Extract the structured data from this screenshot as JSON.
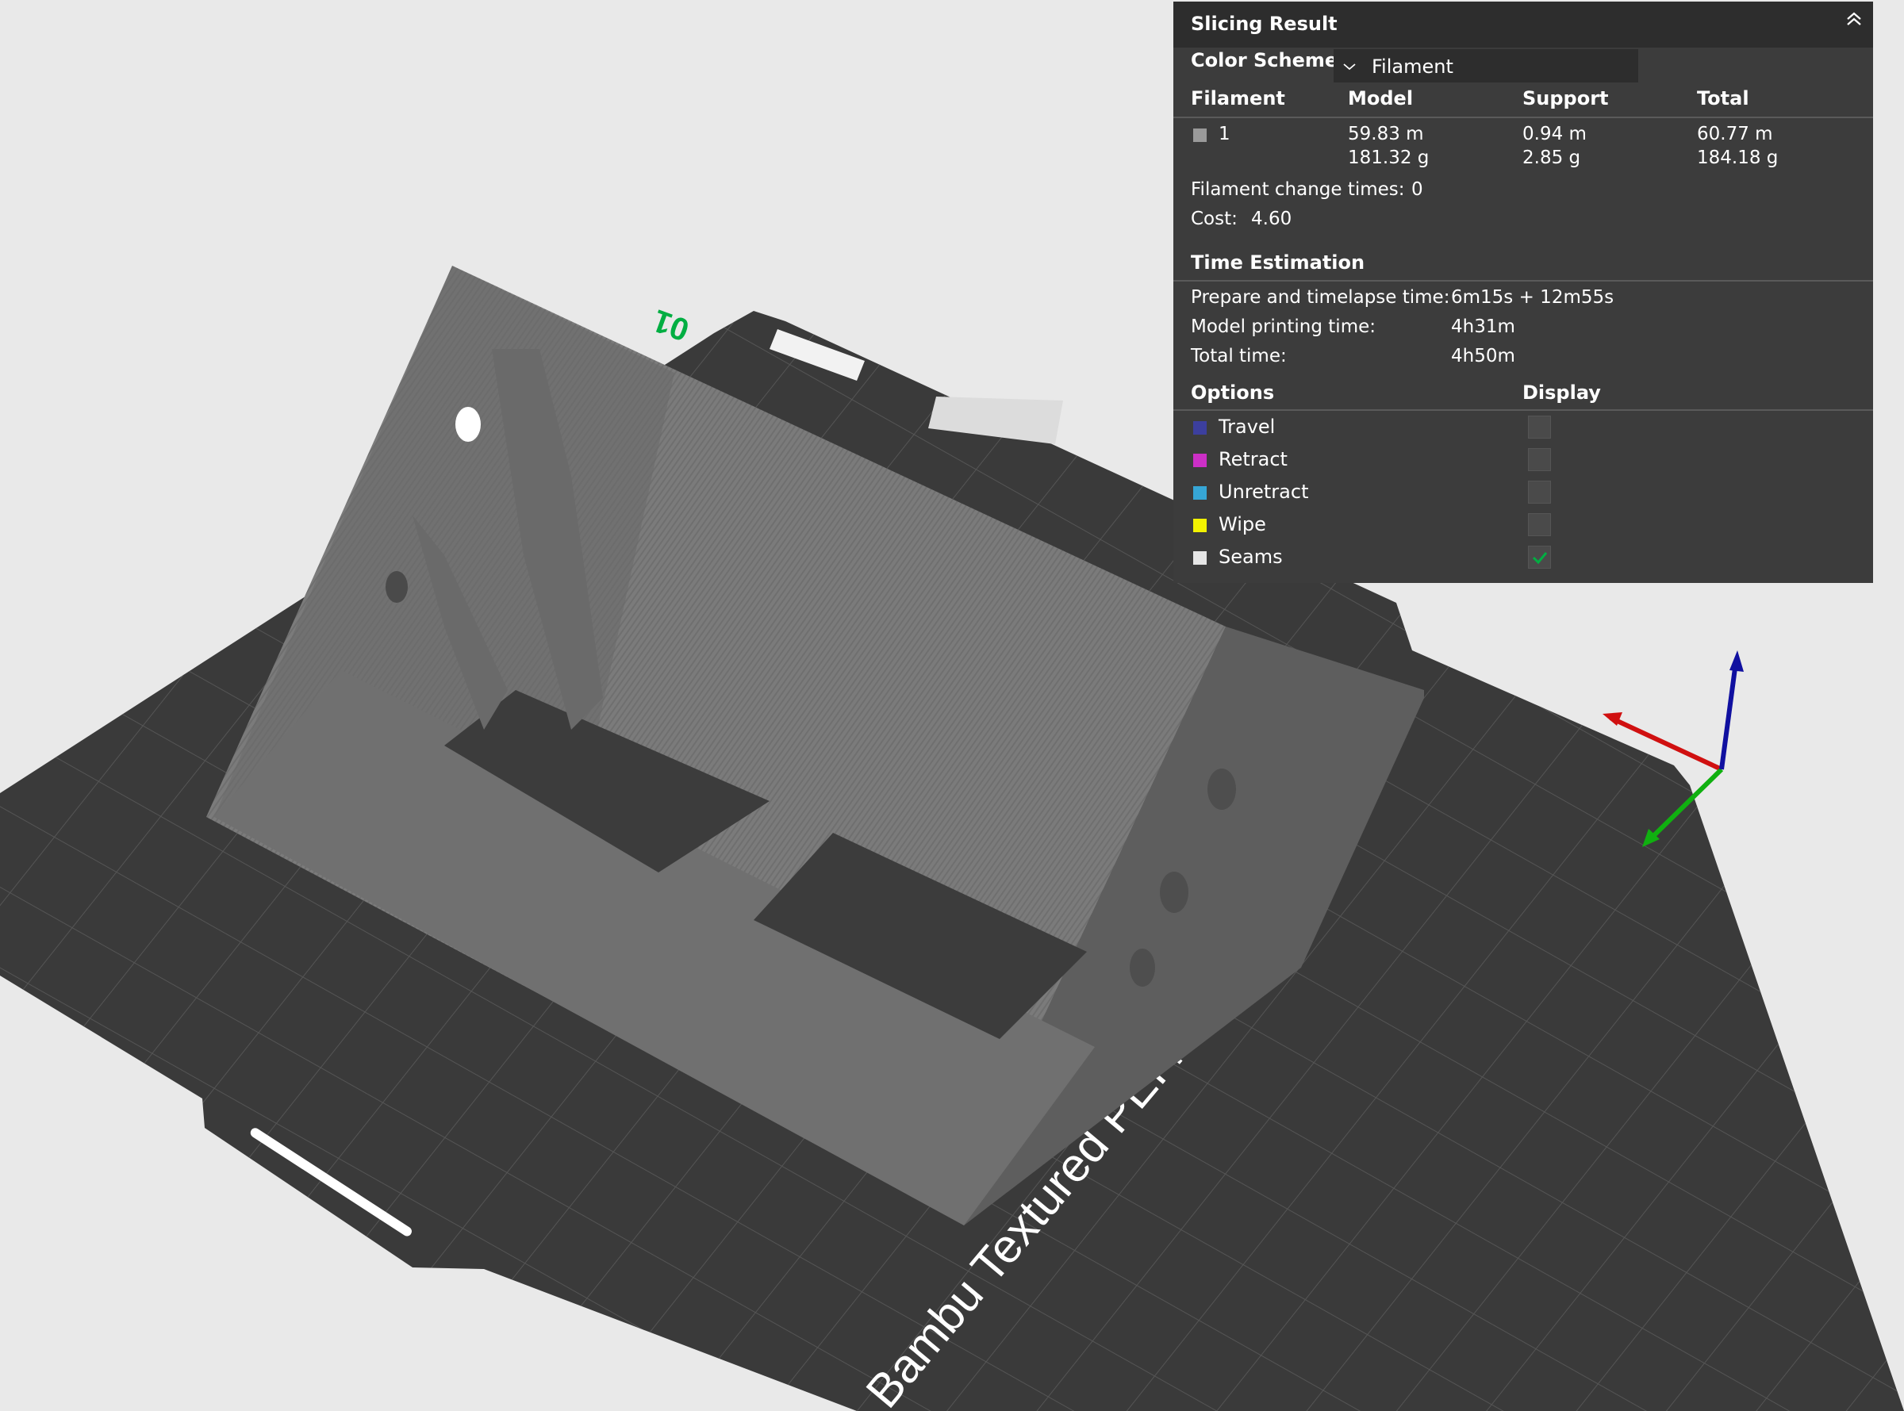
{
  "panel": {
    "title": "Slicing Result",
    "color_scheme_label": "Color Scheme",
    "color_scheme_value": "Filament",
    "table": {
      "headers": [
        "Filament",
        "Model",
        "Support",
        "Total"
      ],
      "rows": [
        {
          "filament": "1",
          "model_length": "59.83 m",
          "model_weight": "181.32 g",
          "support_length": "0.94 m",
          "support_weight": "2.85 g",
          "total_length": "60.77 m",
          "total_weight": "184.18 g"
        }
      ]
    },
    "filament_change_label": "Filament change times:",
    "filament_change_value": "0",
    "cost_label": "Cost:",
    "cost_value": "4.60",
    "time_estimation": {
      "title": "Time Estimation",
      "rows": [
        {
          "label": "Prepare and timelapse time:",
          "value": "6m15s + 12m55s"
        },
        {
          "label": "Model printing time:",
          "value": "4h31m"
        },
        {
          "label": "Total time:",
          "value": "4h50m"
        }
      ]
    },
    "options": {
      "title": "Options",
      "display_title": "Display",
      "items": [
        {
          "label": "Travel",
          "color": "#3c3f9e",
          "checked": false
        },
        {
          "label": "Retract",
          "color": "#cc2fc6",
          "checked": false
        },
        {
          "label": "Unretract",
          "color": "#36a6d6",
          "checked": false
        },
        {
          "label": "Wipe",
          "color": "#f2f200",
          "checked": false
        },
        {
          "label": "Seams",
          "color": "#e6e6e6",
          "checked": true
        }
      ]
    },
    "filament_swatch_color": "#9a9a9a",
    "check_color": "#00ae42"
  },
  "viewport": {
    "plate_label": "Bambu Textured PEI Plate",
    "plate_number": "01",
    "plate_color": "#3a3a3a",
    "model_color": "#7c7c7c",
    "background_color": "#e9e9e9",
    "axis_colors": {
      "x": "#d01010",
      "y": "#10b010",
      "z": "#1010a0"
    }
  }
}
